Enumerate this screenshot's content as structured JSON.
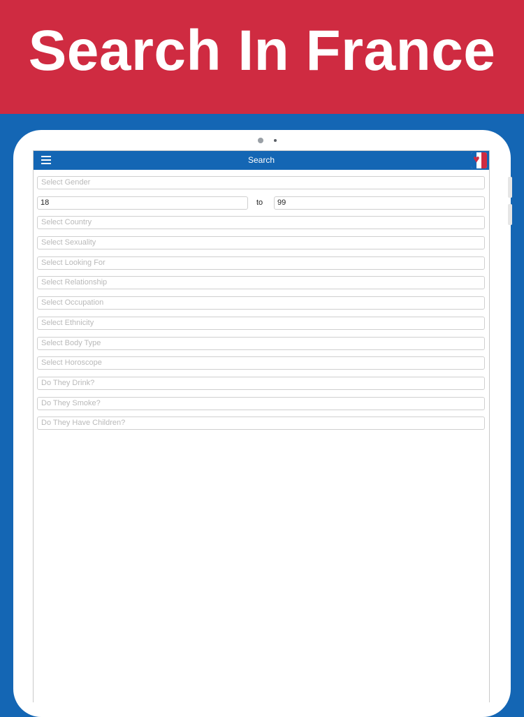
{
  "banner": {
    "title": "Search In France"
  },
  "navbar": {
    "title": "Search",
    "menu_icon": "hamburger-menu-icon",
    "logo_icon": "app-logo-heart"
  },
  "form": {
    "gender_placeholder": "Select Gender",
    "age": {
      "min": "18",
      "separator": "to",
      "max": "99"
    },
    "selects": [
      {
        "name": "country",
        "placeholder": "Select Country"
      },
      {
        "name": "sexuality",
        "placeholder": "Select Sexuality"
      },
      {
        "name": "looking-for",
        "placeholder": "Select Looking For"
      },
      {
        "name": "relationship",
        "placeholder": "Select Relationship"
      },
      {
        "name": "occupation",
        "placeholder": "Select Occupation"
      },
      {
        "name": "ethnicity",
        "placeholder": "Select Ethnicity"
      },
      {
        "name": "body-type",
        "placeholder": "Select Body Type"
      },
      {
        "name": "horoscope",
        "placeholder": "Select Horoscope"
      },
      {
        "name": "drink",
        "placeholder": "Do They Drink?"
      },
      {
        "name": "smoke",
        "placeholder": "Do They Smoke?"
      },
      {
        "name": "children",
        "placeholder": "Do They Have Children?"
      }
    ]
  },
  "colors": {
    "banner_red": "#cf2b41",
    "brand_blue": "#1466b4",
    "background": "#ffffff"
  }
}
